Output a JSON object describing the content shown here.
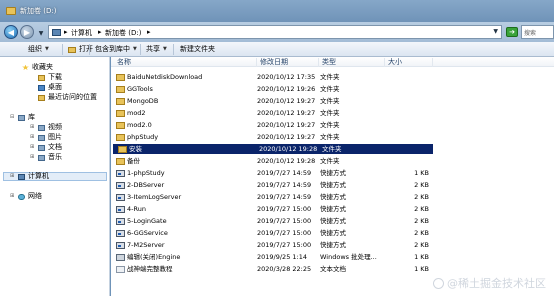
{
  "window": {
    "title": "新加卷 (D:)"
  },
  "navigation": {
    "breadcrumb": [
      "计算机",
      "新加卷 (D:)"
    ],
    "search_placeholder": "搜索"
  },
  "toolbar": {
    "organize": "组织",
    "open": "打开",
    "include_in_library": "包含到库中",
    "share": "共享",
    "new_folder": "新建文件夹"
  },
  "sidebar": {
    "favorites": {
      "label": "收藏夹",
      "items": [
        "下载",
        "桌面",
        "最近访问的位置"
      ]
    },
    "libraries": {
      "label": "库",
      "items": [
        "视频",
        "图片",
        "文档",
        "音乐"
      ]
    },
    "computer": "计算机",
    "network": "网络"
  },
  "columns": {
    "name": "名称",
    "date": "修改日期",
    "type": "类型",
    "size": "大小"
  },
  "files": [
    {
      "name": "BaiduNetdiskDownload",
      "date": "2020/10/12 17:35",
      "type": "文件夹",
      "size": "",
      "icon": "folder"
    },
    {
      "name": "GGTools",
      "date": "2020/10/12 19:26",
      "type": "文件夹",
      "size": "",
      "icon": "folder"
    },
    {
      "name": "MongoDB",
      "date": "2020/10/12 19:27",
      "type": "文件夹",
      "size": "",
      "icon": "folder"
    },
    {
      "name": "mod2",
      "date": "2020/10/12 19:27",
      "type": "文件夹",
      "size": "",
      "icon": "folder"
    },
    {
      "name": "mod2.0",
      "date": "2020/10/12 19:27",
      "type": "文件夹",
      "size": "",
      "icon": "folder"
    },
    {
      "name": "phpStudy",
      "date": "2020/10/12 19:27",
      "type": "文件夹",
      "size": "",
      "icon": "folder"
    },
    {
      "name": "安装",
      "date": "2020/10/12 19:28",
      "type": "文件夹",
      "size": "",
      "icon": "folder",
      "selected": true
    },
    {
      "name": "备份",
      "date": "2020/10/12 19:28",
      "type": "文件夹",
      "size": "",
      "icon": "folder"
    },
    {
      "name": "1-phpStudy",
      "date": "2019/7/27 14:59",
      "type": "快捷方式",
      "size": "1 KB",
      "icon": "shortcut"
    },
    {
      "name": "2-DBServer",
      "date": "2019/7/27 14:59",
      "type": "快捷方式",
      "size": "2 KB",
      "icon": "shortcut"
    },
    {
      "name": "3-ItemLogServer",
      "date": "2019/7/27 14:59",
      "type": "快捷方式",
      "size": "2 KB",
      "icon": "shortcut"
    },
    {
      "name": "4-Run",
      "date": "2019/7/27 15:00",
      "type": "快捷方式",
      "size": "2 KB",
      "icon": "shortcut"
    },
    {
      "name": "5-LoginGate",
      "date": "2019/7/27 15:00",
      "type": "快捷方式",
      "size": "2 KB",
      "icon": "shortcut"
    },
    {
      "name": "6-GGService",
      "date": "2019/7/27 15:00",
      "type": "快捷方式",
      "size": "2 KB",
      "icon": "shortcut"
    },
    {
      "name": "7-M2Server",
      "date": "2019/7/27 15:00",
      "type": "快捷方式",
      "size": "2 KB",
      "icon": "shortcut"
    },
    {
      "name": "编辑(关闭)Engine",
      "date": "2019/9/25 1:14",
      "type": "Windows 批处理...",
      "size": "1 KB",
      "icon": "bat"
    },
    {
      "name": "战神端完整教程",
      "date": "2020/3/28 22:25",
      "type": "文本文档",
      "size": "1 KB",
      "icon": "file"
    }
  ],
  "watermark": "@稀土掘金技术社区"
}
